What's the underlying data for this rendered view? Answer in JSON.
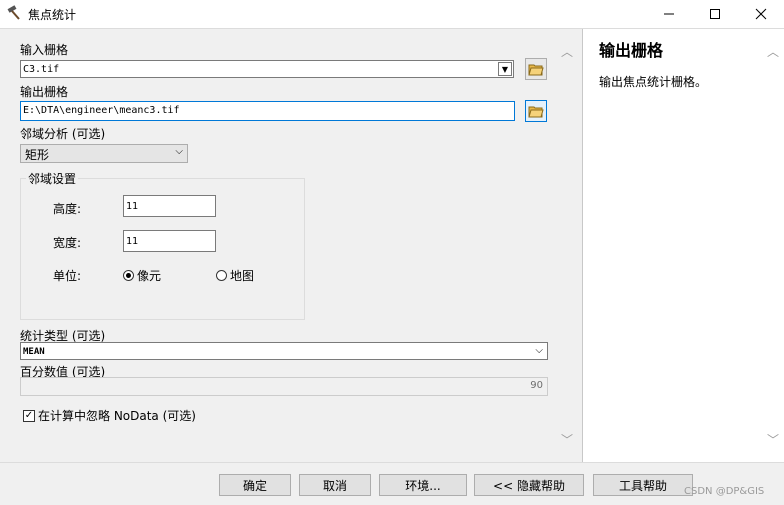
{
  "window": {
    "title": "焦点统计"
  },
  "fields": {
    "input_raster": {
      "label": "输入栅格",
      "value": "C3.tif"
    },
    "output_raster": {
      "label": "输出栅格",
      "value": "E:\\DTA\\engineer\\meanc3.tif"
    },
    "neighborhood": {
      "label": "邻域分析 (可选)",
      "value": "矩形"
    },
    "neighborhood_settings": {
      "legend": "邻域设置",
      "height": {
        "label": "高度:",
        "value": "11"
      },
      "width": {
        "label": "宽度:",
        "value": "11"
      },
      "units": {
        "label": "单位:",
        "options": [
          "像元",
          "地图"
        ],
        "selected": "像元"
      }
    },
    "statistics_type": {
      "label": "统计类型 (可选)",
      "value": "MEAN"
    },
    "percentile": {
      "label": "百分数值 (可选)",
      "value": "90"
    },
    "ignore_nodata": {
      "label": "在计算中忽略 NoData (可选)",
      "checked": true
    }
  },
  "help": {
    "title": "输出栅格",
    "text": "输出焦点统计栅格。"
  },
  "buttons": {
    "ok": "确定",
    "cancel": "取消",
    "environments": "环境...",
    "hide_help": "<< 隐藏帮助",
    "tool_help": "工具帮助"
  },
  "watermark": "CSDN @DP&GIS"
}
